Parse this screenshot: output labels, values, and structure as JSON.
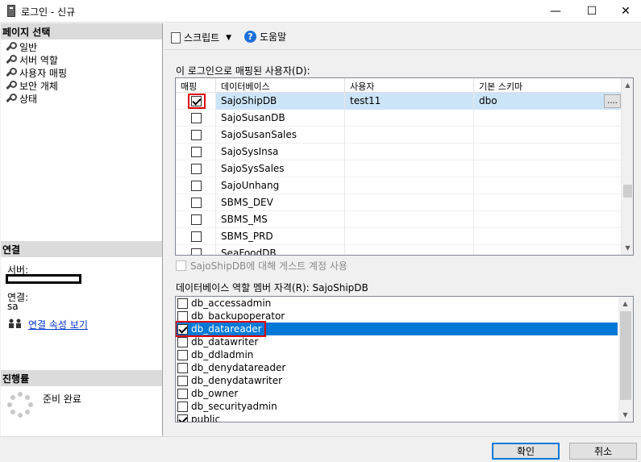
{
  "window": {
    "title": "로그인 - 신규",
    "minimize_glyph": "—",
    "maximize_glyph": "☐",
    "close_glyph": "✕"
  },
  "left": {
    "page_select_header": "페이지 선택",
    "nav_items": [
      "일반",
      "서버 역할",
      "사용자 매핑",
      "보안 개체",
      "상태"
    ],
    "connection_header": "연결",
    "server_label": "서버:",
    "conn_label": "연결:",
    "conn_value": "sa",
    "view_conn_props": "연결 속성 보기",
    "progress_header": "진행률",
    "progress_status": "준비 완료"
  },
  "toolbar": {
    "script_label": "스크립트",
    "help_label": "도움말"
  },
  "mapping": {
    "label": "이 로그인으로 매핑된 사용자(D):",
    "columns": [
      "매핑",
      "데이터베이스",
      "사용자",
      "기본 스키마"
    ],
    "rows": [
      {
        "mapped": true,
        "db": "SajoShipDB",
        "user": "test11",
        "schema": "dbo",
        "selected": true
      },
      {
        "mapped": false,
        "db": "SajoSusanDB",
        "user": "",
        "schema": ""
      },
      {
        "mapped": false,
        "db": "SajoSusanSales",
        "user": "",
        "schema": ""
      },
      {
        "mapped": false,
        "db": "SajoSysInsa",
        "user": "",
        "schema": ""
      },
      {
        "mapped": false,
        "db": "SajoSysSales",
        "user": "",
        "schema": ""
      },
      {
        "mapped": false,
        "db": "SajoUnhang",
        "user": "",
        "schema": ""
      },
      {
        "mapped": false,
        "db": "SBMS_DEV",
        "user": "",
        "schema": ""
      },
      {
        "mapped": false,
        "db": "SBMS_MS",
        "user": "",
        "schema": ""
      },
      {
        "mapped": false,
        "db": "SBMS_PRD",
        "user": "",
        "schema": ""
      },
      {
        "mapped": false,
        "db": "SeaFoodDB",
        "user": "",
        "schema": ""
      }
    ],
    "ellipsis_button": "....",
    "guest_label": "SajoShipDB에 대해 게스트 계정 사용"
  },
  "roles": {
    "label": "데이터베이스 역할 멤버 자격(R): SajoShipDB",
    "items": [
      {
        "name": "db_accessadmin",
        "checked": false
      },
      {
        "name": "db_backupoperator",
        "checked": false
      },
      {
        "name": "db_datareader",
        "checked": true,
        "selected": true
      },
      {
        "name": "db_datawriter",
        "checked": false
      },
      {
        "name": "db_ddladmin",
        "checked": false
      },
      {
        "name": "db_denydatareader",
        "checked": false
      },
      {
        "name": "db_denydatawriter",
        "checked": false
      },
      {
        "name": "db_owner",
        "checked": false
      },
      {
        "name": "db_securityadmin",
        "checked": false
      },
      {
        "name": "public",
        "checked": true
      }
    ]
  },
  "buttons": {
    "ok": "확인",
    "cancel": "취소"
  },
  "colors": {
    "selection": "#0078d7",
    "highlight_box": "#e00000",
    "link": "#0033cc"
  }
}
